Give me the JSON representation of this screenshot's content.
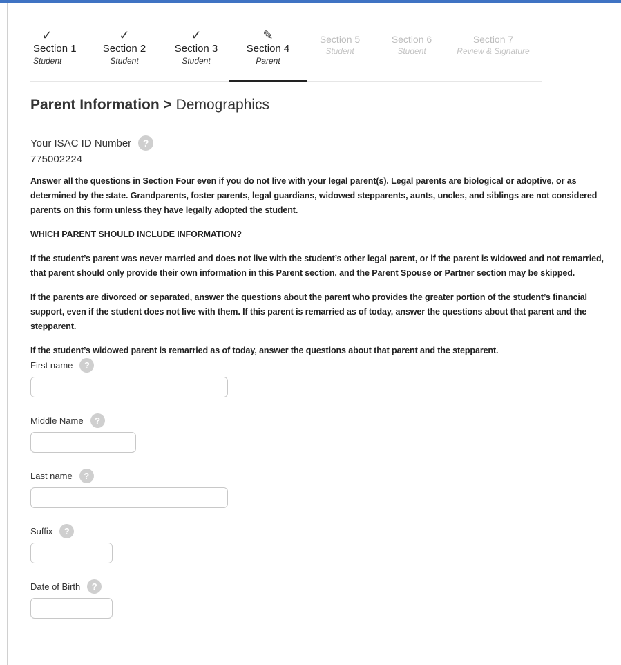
{
  "steps": [
    {
      "mark": "✓",
      "title": "Section 1",
      "sub": "Student"
    },
    {
      "mark": "✓",
      "title": "Section 2",
      "sub": "Student"
    },
    {
      "mark": "✓",
      "title": "Section 3",
      "sub": "Student"
    },
    {
      "mark": "✎",
      "title": "Section 4",
      "sub": "Parent"
    },
    {
      "mark": "",
      "title": "Section 5",
      "sub": "Student"
    },
    {
      "mark": "",
      "title": "Section 6",
      "sub": "Student"
    },
    {
      "mark": "",
      "title": "Section 7",
      "sub": "Review & Signature"
    }
  ],
  "heading": {
    "strong": "Parent Information",
    "sep": ">",
    "rest": "Demographics"
  },
  "isac": {
    "label": "Your ISAC ID Number",
    "value": "775002224"
  },
  "help_glyph": "?",
  "paragraphs": {
    "p1": "Answer all the questions in Section Four even if you do not live with your legal parent(s). Legal parents are biological or adoptive, or as determined by the state. Grandparents, foster parents, legal guardians, widowed stepparents, aunts, uncles, and siblings are not considered parents on this form unless they have legally adopted the student.",
    "p2": "WHICH PARENT SHOULD INCLUDE INFORMATION?",
    "p3": "If the student’s parent was never married and does not live with the student’s other legal parent, or if the parent is widowed and not remarried, that parent should only provide their own information in this Parent section, and the Parent Spouse or Partner section may be skipped.",
    "p4": "If the parents are divorced or separated, answer the questions about the parent who provides the greater portion of the student’s financial support, even if the student does not live with them. If this parent is remarried as of today, answer the questions about that parent and the stepparent.",
    "p5": "If the student’s widowed parent is remarried as of today, answer the questions about that parent and the stepparent."
  },
  "fields": {
    "first_name": {
      "label": "First name",
      "value": ""
    },
    "middle_name": {
      "label": "Middle Name",
      "value": ""
    },
    "last_name": {
      "label": "Last name",
      "value": ""
    },
    "suffix": {
      "label": "Suffix",
      "value": ""
    },
    "dob": {
      "label": "Date of Birth",
      "value": ""
    }
  },
  "colors": {
    "accent": "#3f73c3",
    "help_bg": "#cfcfcf"
  }
}
